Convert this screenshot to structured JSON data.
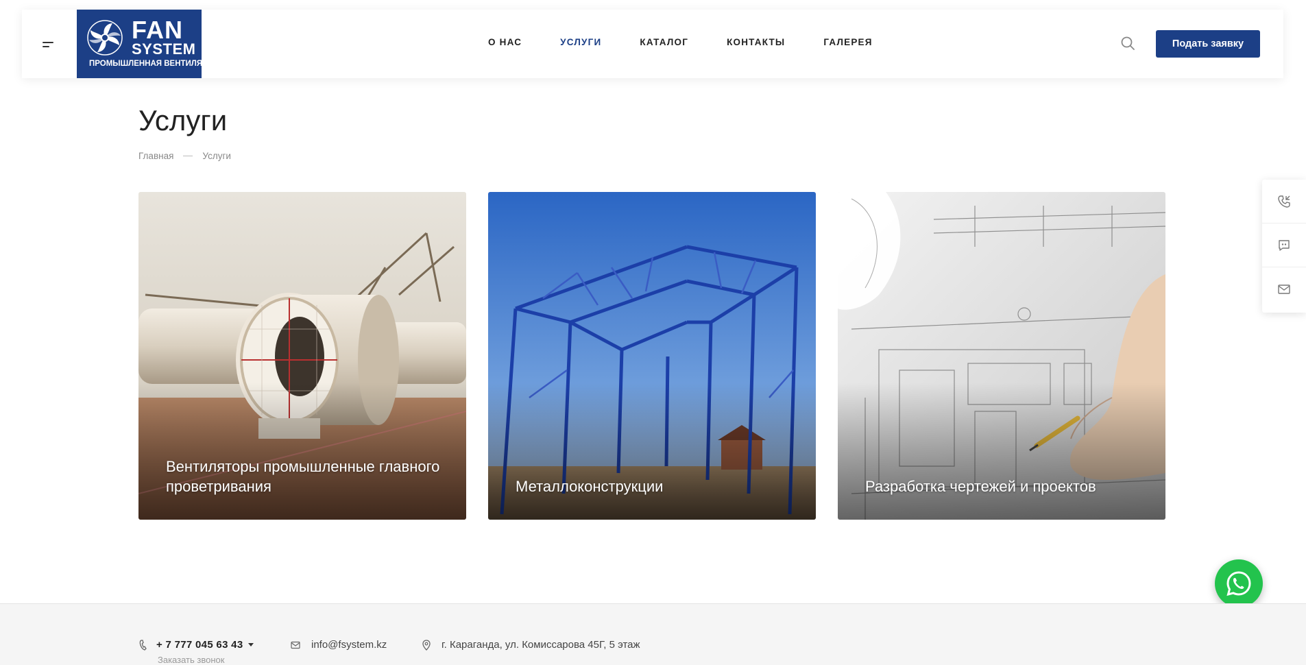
{
  "brand": {
    "name_line1": "FAN",
    "name_line2": "SYSTEM",
    "tagline": "ПРОМЫШЛЕННАЯ ВЕНТИЛЯЦИЯ",
    "primary_color": "#1c3f86"
  },
  "nav": {
    "items": [
      {
        "label": "О НАС",
        "active": false
      },
      {
        "label": "УСЛУГИ",
        "active": true
      },
      {
        "label": "КАТАЛОГ",
        "active": false
      },
      {
        "label": "КОНТАКТЫ",
        "active": false
      },
      {
        "label": "ГАЛЕРЕЯ",
        "active": false
      }
    ],
    "search_icon": "search-icon",
    "cta_label": "Подать заявку"
  },
  "page": {
    "title": "Услуги",
    "breadcrumb": [
      "Главная",
      "Услуги"
    ]
  },
  "services": [
    {
      "label": "Вентиляторы промышленные главного проветривания",
      "image": "industrial-fan-photo"
    },
    {
      "label": "Металлоконструкции",
      "image": "steel-frame-photo"
    },
    {
      "label": "Разработка чертежей и проектов",
      "image": "blueprint-drawing-photo"
    }
  ],
  "side_panel": {
    "icons": [
      "phone-callback-icon",
      "chat-icon",
      "mail-icon"
    ]
  },
  "whatsapp": {
    "icon": "whatsapp-icon",
    "color": "#23c34d"
  },
  "footer": {
    "phone": "+ 7 777 045 63 43",
    "callback_label": "Заказать звонок",
    "email": "info@fsystem.kz",
    "address": "г. Караганда, ул. Комиссарова 45Г, 5 этаж"
  }
}
